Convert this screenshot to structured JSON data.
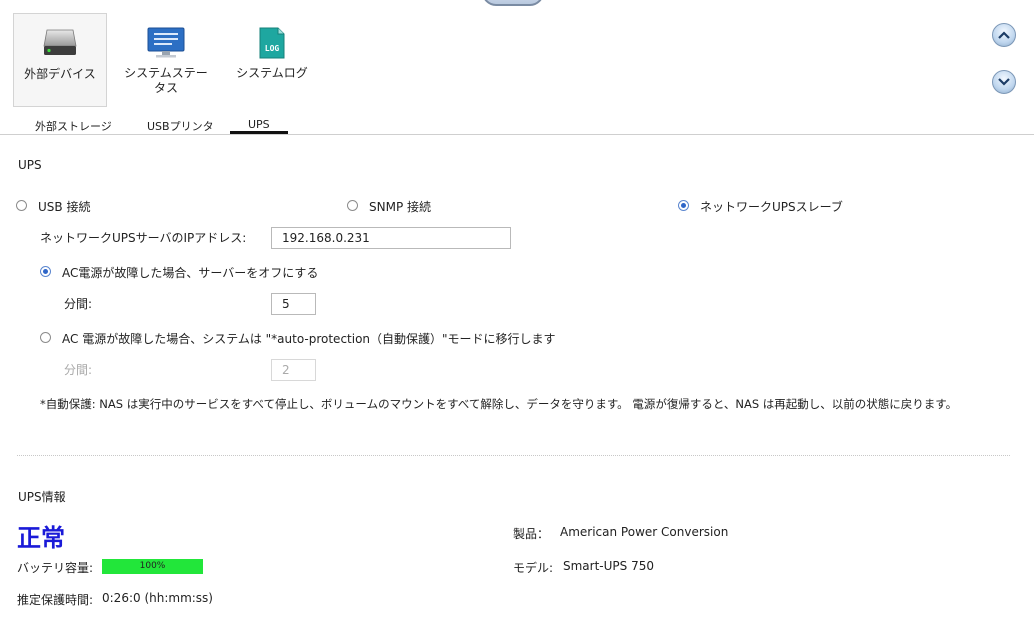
{
  "icons": [
    {
      "label": "外部デバイス",
      "icon": "external-drive-icon"
    },
    {
      "label": "システムステータス",
      "icon": "monitor-icon"
    },
    {
      "label": "システムログ",
      "icon": "log-icon",
      "badge": "LOG"
    }
  ],
  "tabs": [
    "外部ストレージ",
    "USBプリンタ",
    "UPS"
  ],
  "ups": {
    "section_title": "UPS",
    "modes": [
      "USB 接続",
      "SNMP 接続",
      "ネットワークUPSスレーブ"
    ],
    "ip_label": "ネットワークUPSサーバのIPアドレス:",
    "ip_value": "192.168.0.231",
    "option1_label": "AC電源が故障した場合、サーバーをオフにする",
    "option1_minutes_label": "分間:",
    "option1_minutes": "5",
    "option2_label": "AC 電源が故障した場合、システムは \"*auto-protection（自動保護）\"モードに移行します",
    "option2_minutes_label": "分間:",
    "option2_minutes": "2",
    "note": "*自動保護: NAS は実行中のサービスをすべて停止し、ボリュームのマウントをすべて解除し、データを守ります。 電源が復帰すると、NAS は再起動し、以前の状態に戻ります。"
  },
  "info": {
    "section_title": "UPS情報",
    "status": "正常",
    "battery_label": "バッテリ容量:",
    "battery_percent": "100%",
    "battery_fraction": 1.0,
    "runtime_label": "推定保護時間:",
    "runtime_value": "0:26:0 (hh:mm:ss)",
    "product_label": "製品：",
    "product_value": "American Power Conversion",
    "model_label": "モデル:",
    "model_value": "Smart-UPS 750"
  },
  "colors": {
    "accent": "#2f66c8",
    "status": "#1a1ad8",
    "battery": "#22e63a"
  }
}
